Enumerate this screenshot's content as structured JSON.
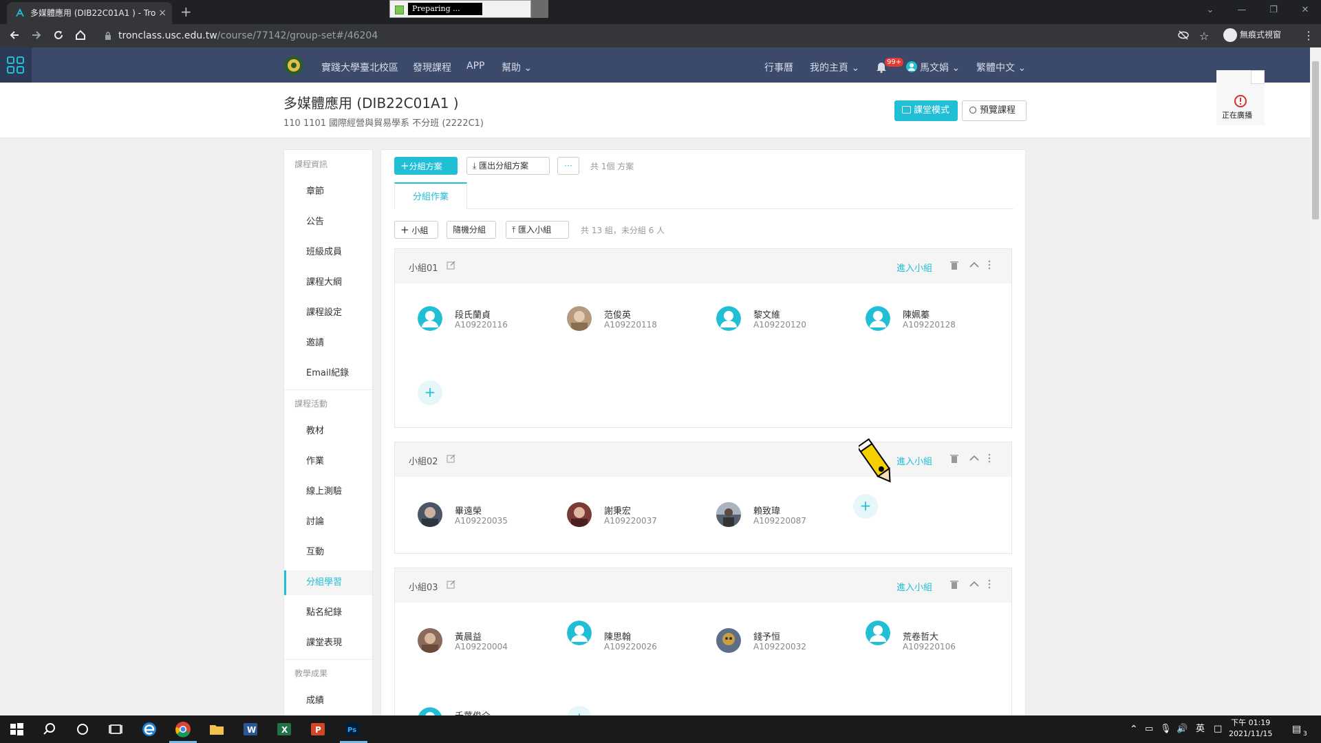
{
  "browser": {
    "tab_title": "多媒體應用 (DIB22C01A1 ) - Tro",
    "tab_close": "×",
    "new_tab": "+",
    "url_host": "tronclass.usc.edu.tw",
    "url_path": "/course/77142/group-set#/46204",
    "incognito_label": "無痕式視窗",
    "recorder_status": "Preparing ..."
  },
  "navbar": {
    "school": "實踐大學臺北校區",
    "discover": "發現課程",
    "app": "APP",
    "help": "幫助",
    "calendar": "行事曆",
    "my_home": "我的主頁",
    "notif_badge": "99+",
    "user": "馬文娟",
    "language": "繁體中文"
  },
  "course": {
    "title": "多媒體應用 (DIB22C01A1 )",
    "subtitle": "110 1101 國際經營與貿易學系 不分班 (2222C1)",
    "classroom_btn": "課堂模式",
    "preview_btn": "預覽課程",
    "broadcast": "正在廣播"
  },
  "sidebar": {
    "section1": "課程資訊",
    "items1": [
      "章節",
      "公告",
      "班級成員",
      "課程大綱",
      "課程設定",
      "邀請",
      "Email紀錄"
    ],
    "section2": "課程活動",
    "items2": [
      "教材",
      "作業",
      "線上測驗",
      "討論",
      "互動",
      "分組學習",
      "點名紀錄",
      "課堂表現"
    ],
    "section3": "教學成果",
    "items3": [
      "成績"
    ],
    "active": "分組學習"
  },
  "toolbar": {
    "add_plan": "分組方案",
    "export_plan": "匯出分組方案",
    "more": "···",
    "plan_count": "共 1個 方案",
    "tab": "分組作業",
    "add_group": "小組",
    "random": "隨機分組",
    "import": "匯入小組",
    "summary": "共 13 組，未分組 6 人"
  },
  "groups": [
    {
      "name": "小組01",
      "enter": "進入小組",
      "members": [
        {
          "name": "段氏蘭貞",
          "id": "A109220116",
          "avatar": "default"
        },
        {
          "name": "范俊英",
          "id": "A109220118",
          "avatar": "photo",
          "color": "#b59a7e"
        },
        {
          "name": "黎文維",
          "id": "A109220120",
          "avatar": "default"
        },
        {
          "name": "陳姵蓁",
          "id": "A109220128",
          "avatar": "default"
        }
      ]
    },
    {
      "name": "小組02",
      "enter": "進入小組",
      "members": [
        {
          "name": "畢遠榮",
          "id": "A109220035",
          "avatar": "photo",
          "color": "#4a5566"
        },
        {
          "name": "謝秉宏",
          "id": "A109220037",
          "avatar": "photo",
          "color": "#7a3b36"
        },
        {
          "name": "賴致瑋",
          "id": "A109220087",
          "avatar": "photo",
          "color": "#556070"
        }
      ]
    },
    {
      "name": "小組03",
      "enter": "進入小組",
      "members": [
        {
          "name": "黃晨益",
          "id": "A109220004",
          "avatar": "photo",
          "color": "#8a6a5a"
        },
        {
          "name": "陳思翰",
          "id": "A109220026",
          "avatar": "default"
        },
        {
          "name": "錢予恒",
          "id": "A109220032",
          "avatar": "photo",
          "color": "#5d6f86"
        },
        {
          "name": "荒卷哲大",
          "id": "A109220106",
          "avatar": "default"
        },
        {
          "name": "千葉俊介",
          "id": "",
          "avatar": "default"
        }
      ]
    }
  ],
  "taskbar": {
    "time": "下午 01:19",
    "date": "2021/11/15",
    "ime": "英",
    "notif_count": "3"
  },
  "colors": {
    "accent": "#20bfd6",
    "navbar": "#3b4a6b",
    "chrome": "#202124"
  }
}
